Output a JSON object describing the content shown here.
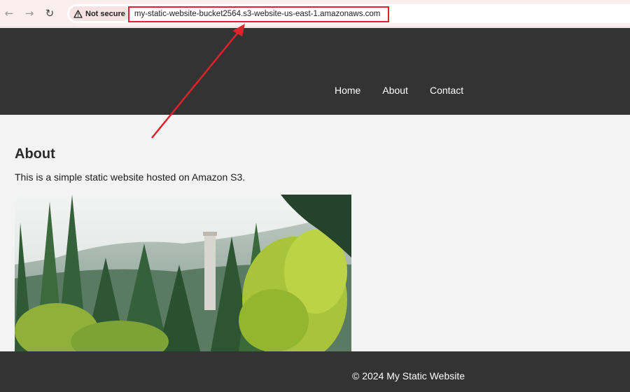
{
  "browser": {
    "back_icon": "arrow-left-icon",
    "forward_icon": "arrow-right-icon",
    "reload_icon": "reload-icon",
    "security_label": "Not secure",
    "url": "my-static-website-bucket2564.s3-website-us-east-1.amazonaws.com"
  },
  "nav": {
    "items": [
      {
        "label": "Home"
      },
      {
        "label": "About"
      },
      {
        "label": "Contact"
      }
    ]
  },
  "main": {
    "heading": "About",
    "text": "This is a simple static website hosted on Amazon S3."
  },
  "footer": {
    "text": "© 2024 My Static Website"
  },
  "colors": {
    "header_bg": "#333333",
    "page_bg": "#f3f3f3",
    "annotation_red": "#e0222a"
  }
}
